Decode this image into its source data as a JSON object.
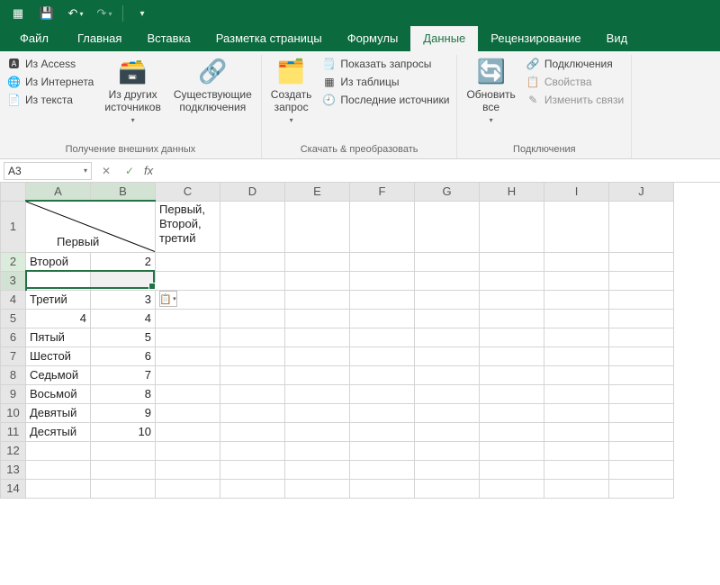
{
  "qat": {
    "save_tip": "Save",
    "undo_tip": "Undo",
    "redo_tip": "Redo"
  },
  "tabs": {
    "file": "Файл",
    "home": "Главная",
    "insert": "Вставка",
    "layout": "Разметка страницы",
    "formulas": "Формулы",
    "data": "Данные",
    "review": "Рецензирование",
    "view": "Вид"
  },
  "ribbon": {
    "group1": {
      "access": "Из Access",
      "web": "Из Интернета",
      "text": "Из текста",
      "other": "Из других\nисточников",
      "existing": "Существующие\nподключения",
      "label": "Получение внешних данных"
    },
    "group2": {
      "newquery": "Создать\nзапрос",
      "showq": "Показать запросы",
      "fromtable": "Из таблицы",
      "recent": "Последние источники",
      "label": "Скачать & преобразовать"
    },
    "group3": {
      "refresh": "Обновить\nвсе",
      "conn": "Подключения",
      "props": "Свойства",
      "edit": "Изменить связи",
      "label": "Подключения"
    }
  },
  "namebox": "A3",
  "columns": [
    "A",
    "B",
    "C",
    "D",
    "E",
    "F",
    "G",
    "H",
    "I",
    "J"
  ],
  "rows_shown": 14,
  "a1_label": "Первый",
  "c1": "Первый, Второй, третий",
  "cells": {
    "A2": "Второй",
    "B2": "2",
    "A4": "Третий",
    "B4": "3",
    "A5": "4",
    "B5": "4",
    "A6": "Пятый",
    "B6": "5",
    "A7": "Шестой",
    "B7": "6",
    "A8": "Седьмой",
    "B8": "7",
    "A9": "Восьмой",
    "B9": "8",
    "A10": "Девятый",
    "B10": "9",
    "A11": "Десятый",
    "B11": "10"
  },
  "selection": {
    "ref": "A3:B3"
  }
}
